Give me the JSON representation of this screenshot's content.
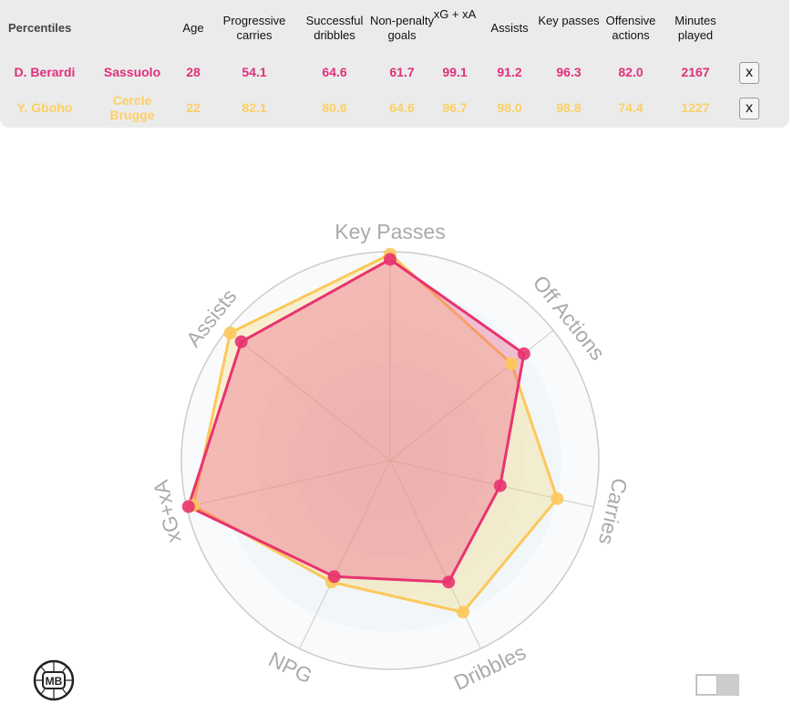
{
  "table": {
    "corner": "Percentiles",
    "headers": [
      "Age",
      "Progressive carries",
      "Successful dribbles",
      "Non-penalty goals",
      "xG + xA",
      "Assists",
      "Key passes",
      "Offensive actions",
      "Minutes played"
    ],
    "rows": [
      {
        "name": "D. Berardi",
        "team": "Sassuolo",
        "values": [
          "28",
          "54.1",
          "64.6",
          "61.7",
          "99.1",
          "91.2",
          "96.3",
          "82.0",
          "2167"
        ],
        "color": "#e0307a",
        "remove": "x"
      },
      {
        "name": "Y. Gboho",
        "team": "Cercle Brugge",
        "values": [
          "22",
          "82.1",
          "80.6",
          "64.6",
          "96.7",
          "98.0",
          "98.8",
          "74.4",
          "1227"
        ],
        "color": "#fcd062",
        "remove": "x"
      }
    ]
  },
  "chart_data": {
    "type": "radar",
    "axes": [
      "Key Passes",
      "Off Actions",
      "Carries",
      "Dribbles",
      "NPG",
      "xG+xA",
      "Assists"
    ],
    "range": [
      0,
      100
    ],
    "series": [
      {
        "name": "D. Berardi",
        "color": "#e8336f",
        "values": [
          96.3,
          82.0,
          54.1,
          64.6,
          61.7,
          99.1,
          91.2
        ]
      },
      {
        "name": "Y. Gboho",
        "color": "#fcc85a",
        "values": [
          98.8,
          74.4,
          82.1,
          80.6,
          64.6,
          96.7,
          98.0
        ]
      }
    ]
  },
  "logo": "MB"
}
